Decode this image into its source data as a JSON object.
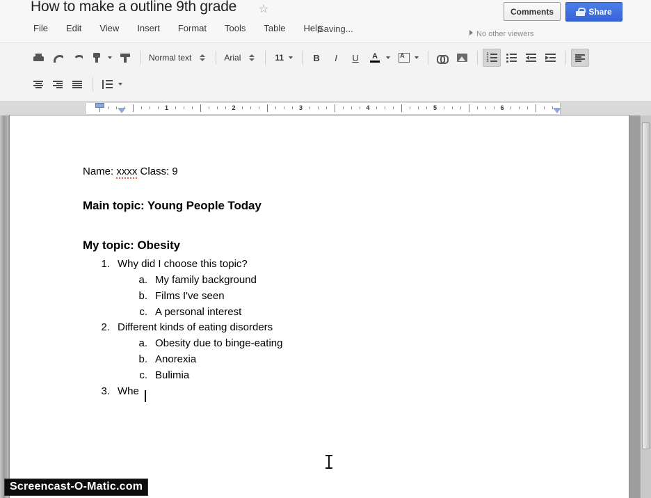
{
  "header": {
    "doc_title": "How to make a outline 9th grade",
    "star_icon": "star-icon",
    "menus": [
      "File",
      "Edit",
      "View",
      "Insert",
      "Format",
      "Tools",
      "Table",
      "Help"
    ],
    "saving_status": "Saving...",
    "viewers_label": "No other viewers",
    "comments_label": "Comments",
    "share_label": "Share",
    "share_color": "#3463d8"
  },
  "toolbar": {
    "print_icon": "print-icon",
    "undo_icon": "undo-icon",
    "redo_icon": "redo-icon",
    "paint_format_icon": "paint-format-icon",
    "brush_icon": "paint-brush-icon",
    "text_style": "Normal text",
    "font_family": "Arial",
    "font_size": "11",
    "bold_label": "B",
    "italic_label": "I",
    "underline_label": "U",
    "text_color_label": "A",
    "link_icon": "link-icon",
    "image_icon": "insert-image-icon",
    "numbered_list_icon": "numbered-list-icon",
    "bulleted_list_icon": "bulleted-list-icon",
    "decrease_indent_icon": "decrease-indent-icon",
    "increase_indent_icon": "increase-indent-icon",
    "align_icon": "align-left-icon",
    "align_center_icon": "align-center-icon",
    "align_right_icon": "align-right-icon",
    "align_justify_icon": "align-justify-icon",
    "line_spacing_icon": "line-spacing-icon"
  },
  "ruler": {
    "numbers": [
      "1",
      "2",
      "3",
      "4",
      "5",
      "6"
    ]
  },
  "document": {
    "name_line_prefix": "Name: ",
    "name_value": "xxxx",
    "name_line_suffix": " Class: 9",
    "heading_main": "Main topic: Young People Today",
    "heading_my": "My topic: Obesity",
    "items": [
      {
        "marker": "1.",
        "text": "Why did I choose this topic?"
      },
      {
        "marker": "a.",
        "text": "My family background"
      },
      {
        "marker": "b.",
        "text": "Films I've seen"
      },
      {
        "marker": "c.",
        "text": "A personal interest"
      },
      {
        "marker": "2.",
        "text": "Different kinds of eating disorders"
      },
      {
        "marker": "a.",
        "text": "Obesity due to binge-eating"
      },
      {
        "marker": "b.",
        "text": "Anorexia"
      },
      {
        "marker": "c.",
        "text": "Bulimia"
      },
      {
        "marker": "3.",
        "text": "Whe"
      }
    ]
  },
  "watermark": {
    "text": "Screencast-O-Matic.com"
  }
}
